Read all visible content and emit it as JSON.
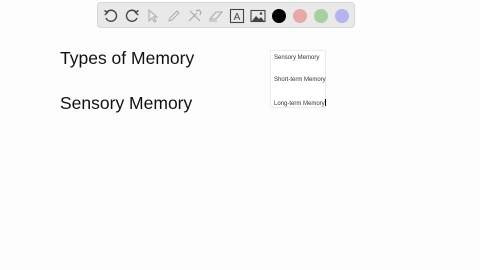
{
  "toolbar": {
    "tools": [
      {
        "name": "undo-icon"
      },
      {
        "name": "redo-icon"
      },
      {
        "name": "select-arrow-icon"
      },
      {
        "name": "pen-icon"
      },
      {
        "name": "tools-icon"
      },
      {
        "name": "eraser-icon"
      },
      {
        "name": "text-icon",
        "glyph": "A"
      },
      {
        "name": "image-icon"
      }
    ],
    "colors": {
      "black": "#000000",
      "red": "#e8a8a8",
      "green": "#a8cfa0",
      "blue": "#b4b4ee"
    }
  },
  "canvas": {
    "heading_1": "Types of Memory",
    "heading_2": "Sensory Memory",
    "list": [
      "Sensory Memory",
      "Short-term Memory",
      "Long-term Memory"
    ]
  }
}
